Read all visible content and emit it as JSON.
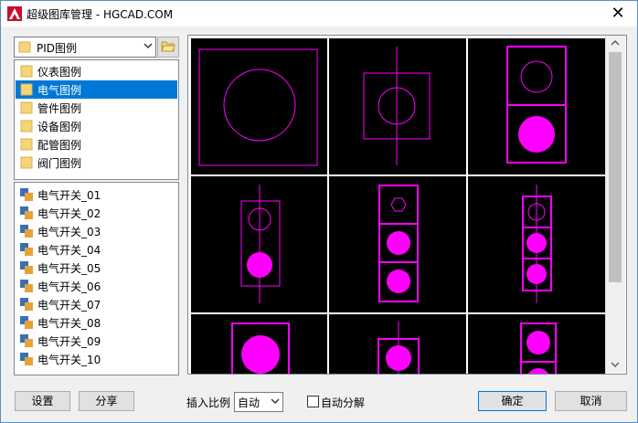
{
  "window": {
    "title": "超级图库管理 - HGCAD.COM",
    "close_glyph": "✕"
  },
  "category_select": {
    "value": "PID图例"
  },
  "categories": [
    {
      "label": "仪表图例",
      "selected": false
    },
    {
      "label": "电气图例",
      "selected": true
    },
    {
      "label": "管件图例",
      "selected": false
    },
    {
      "label": "设备图例",
      "selected": false
    },
    {
      "label": "配管图例",
      "selected": false
    },
    {
      "label": "阀门图例",
      "selected": false
    }
  ],
  "files": [
    {
      "label": "电气开关_01"
    },
    {
      "label": "电气开关_02"
    },
    {
      "label": "电气开关_03"
    },
    {
      "label": "电气开关_04"
    },
    {
      "label": "电气开关_05"
    },
    {
      "label": "电气开关_06"
    },
    {
      "label": "电气开关_07"
    },
    {
      "label": "电气开关_08"
    },
    {
      "label": "电气开关_09"
    },
    {
      "label": "电气开关_10"
    }
  ],
  "buttons": {
    "settings": "设置",
    "share": "分享",
    "ok": "确定",
    "cancel": "取消"
  },
  "insert_scale": {
    "label": "插入比例",
    "value": "自动"
  },
  "auto_explode": {
    "label": "自动分解",
    "checked": false
  },
  "colors": {
    "accent": "#0078d7",
    "symbol": "#ff00ff",
    "canvas": "#000000"
  }
}
